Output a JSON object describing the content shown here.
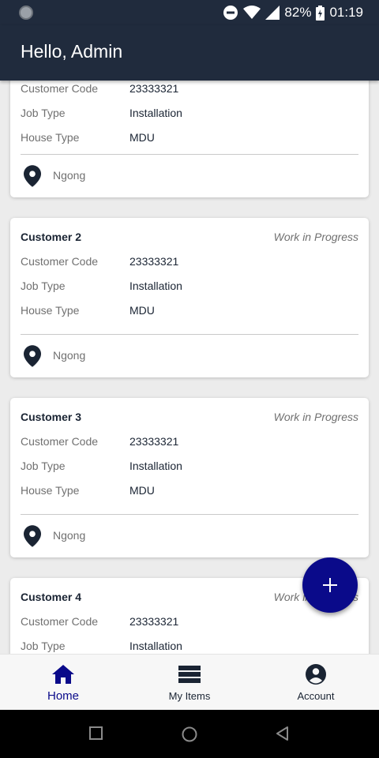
{
  "status_bar": {
    "battery": "82%",
    "time": "01:19"
  },
  "app_bar": {
    "title": "Hello, Admin"
  },
  "cards": [
    {
      "name": "",
      "status": "",
      "rows": [
        {
          "label": "Customer Code",
          "value": "23333321"
        },
        {
          "label": "Job Type",
          "value": "Installation"
        },
        {
          "label": "House Type",
          "value": "MDU"
        }
      ],
      "location": "Ngong"
    },
    {
      "name": "Customer 2",
      "status": "Work in Progress",
      "rows": [
        {
          "label": "Customer Code",
          "value": "23333321"
        },
        {
          "label": "Job Type",
          "value": "Installation"
        },
        {
          "label": "House Type",
          "value": "MDU"
        }
      ],
      "location": "Ngong"
    },
    {
      "name": "Customer 3",
      "status": "Work in Progress",
      "rows": [
        {
          "label": "Customer Code",
          "value": "23333321"
        },
        {
          "label": "Job Type",
          "value": "Installation"
        },
        {
          "label": "House Type",
          "value": "MDU"
        }
      ],
      "location": "Ngong"
    },
    {
      "name": "Customer 4",
      "status": "Work in Progress",
      "rows": [
        {
          "label": "Customer Code",
          "value": "23333321"
        },
        {
          "label": "Job Type",
          "value": "Installation"
        }
      ],
      "location": ""
    }
  ],
  "fab": {
    "icon": "plus-icon"
  },
  "bottom_nav": {
    "items": [
      {
        "label": "Home",
        "icon": "home-icon",
        "active": true
      },
      {
        "label": "My Items",
        "icon": "list-icon",
        "active": false
      },
      {
        "label": "Account",
        "icon": "account-circle-icon",
        "active": false
      }
    ]
  },
  "colors": {
    "app_bar": "#202b3d",
    "accent": "#0a0a8a",
    "text_dark": "#1a2433",
    "text_muted": "#707070"
  }
}
